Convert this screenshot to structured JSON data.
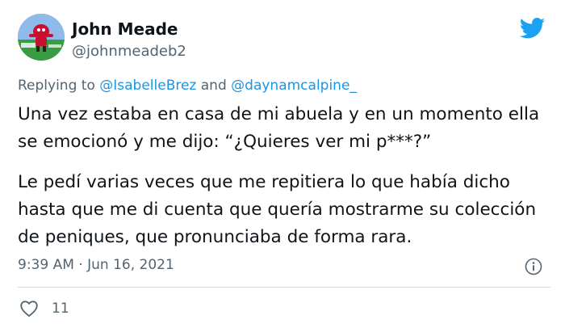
{
  "author": {
    "name": "John Meade",
    "handle": "@johnmeadeb2"
  },
  "reply": {
    "prefix": "Replying to",
    "mention_1": "@IsabelleBrez",
    "conjunction": "and",
    "mention_2": "@daynamcalpine_"
  },
  "tweet": {
    "paragraph_1": "Una vez estaba en casa de mi abuela y en un momento ella se emocionó y me dijo: “¿Quieres ver mi p***?”",
    "paragraph_2": "Le pedí varias veces que me repitiera lo que había dicho hasta que me di cuenta que quería mostrarme su colección de peniques, que pronunciaba de forma rara."
  },
  "meta": {
    "time": "9:39 AM",
    "separator": "·",
    "date": "Jun 16, 2021"
  },
  "engagement": {
    "likes": "11"
  },
  "icons": {
    "brand": "twitter-bird-icon",
    "info": "info-icon",
    "like": "heart-icon"
  },
  "colors": {
    "brand_blue": "#1da1f2",
    "mention_blue": "#1b95e0",
    "secondary_text": "#536471",
    "primary_text": "#0f1419"
  }
}
